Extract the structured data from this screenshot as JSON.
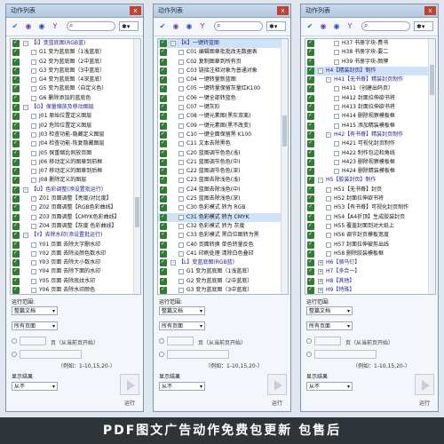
{
  "panels": [
    {
      "title": "动作列表",
      "close_label": "x",
      "scroll_thumb": {
        "top": 0.62,
        "height": 0.12
      },
      "rows": [
        {
          "indent": 0,
          "check": true,
          "expander": "-",
          "label": "【I】变蓝底图(RGB蓝)",
          "group": true
        },
        {
          "indent": 1,
          "check": true,
          "label": "G1 变为蓝底图（1浅蓝底）"
        },
        {
          "indent": 1,
          "check": true,
          "label": "G2 变为蓝底图（2中蓝底）"
        },
        {
          "indent": 1,
          "check": true,
          "label": "G3 变为蓝底图（3中蓝底）"
        },
        {
          "indent": 1,
          "check": true,
          "label": "G4 变为蓝底图（4深蓝底）"
        },
        {
          "indent": 1,
          "check": true,
          "label": "G5 变为蓝底图（自定义色）"
        },
        {
          "indent": 1,
          "check": true,
          "label": "G6 删除添加的蓝底色"
        },
        {
          "indent": 0,
          "check": true,
          "expander": "-",
          "label": "【O】保量缩放及移动图层",
          "group": true
        },
        {
          "indent": 1,
          "check": true,
          "label": "J01 原始位置定义图层"
        },
        {
          "indent": 1,
          "check": true,
          "label": "J02 危险位置定义图层"
        },
        {
          "indent": 1,
          "check": true,
          "label": "J03 检查功能-隐藏定义图层"
        },
        {
          "indent": 1,
          "check": true,
          "label": "J04 检查功能-恢复隐藏图层"
        },
        {
          "indent": 1,
          "check": true,
          "label": "J05 保重缩比例放页图"
        },
        {
          "indent": 1,
          "check": true,
          "label": "J06 移动定义的图章到前框"
        },
        {
          "indent": 1,
          "check": true,
          "label": "J07 移动定义的图章到后框"
        },
        {
          "indent": 1,
          "check": true,
          "label": "J08 删除定义的图层"
        },
        {
          "indent": 0,
          "check": true,
          "expander": "-",
          "label": "【U】色彩调整(添设置批运行)",
          "group": true
        },
        {
          "indent": 1,
          "check": true,
          "label": "Z01 页面调整【亮度/对比度】"
        },
        {
          "indent": 1,
          "check": true,
          "label": "Z02 页面调整【RGB色彩曲线】"
        },
        {
          "indent": 1,
          "check": true,
          "label": "Z03 页面调整【CMYK色彩曲线】"
        },
        {
          "indent": 1,
          "check": true,
          "label": "Z04 页面调整【灰度 色彩曲线】"
        },
        {
          "indent": 0,
          "check": true,
          "expander": "-",
          "label": "【Y】去除水印(添设置批运行)",
          "group": true
        },
        {
          "indent": 1,
          "check": true,
          "label": "Y01 页面 去除大字删水印"
        },
        {
          "indent": 1,
          "check": true,
          "label": "Y02 页面 去除淡颜色数水印"
        },
        {
          "indent": 1,
          "check": true,
          "label": "Y03 页面 去除大小数水印"
        },
        {
          "indent": 1,
          "check": true,
          "label": "Y04 页面 去除下面的水印"
        },
        {
          "indent": 1,
          "check": true,
          "label": "Y05 页面 去除底纹水印"
        },
        {
          "indent": 1,
          "check": true,
          "label": "Y06 页面 去除水印颜色"
        }
      ]
    },
    {
      "title": "动作列表",
      "close_label": "x",
      "scroll_thumb": {
        "top": 0.3,
        "height": 0.12
      },
      "rows": [
        {
          "indent": 0,
          "check": true,
          "expander": "-",
          "label": "【K】一键转蓝图",
          "group": true,
          "selected": true
        },
        {
          "indent": 1,
          "check": true,
          "label": "C01 编辑图章批批改无数据表"
        },
        {
          "indent": 1,
          "check": true,
          "label": "C02 复制图章到所有页"
        },
        {
          "indent": 1,
          "check": true,
          "label": "C03 链接注释对象为普通对象"
        },
        {
          "indent": 1,
          "check": true,
          "label": "C04 一键转量新蓝图"
        },
        {
          "indent": 1,
          "check": true,
          "label": "C05 一键转量保留灰量红K100"
        },
        {
          "indent": 1,
          "check": true,
          "label": "C06 一键全部转蓝色"
        },
        {
          "indent": 1,
          "check": true,
          "label": "C07 一键灰阶"
        },
        {
          "indent": 1,
          "check": true,
          "label": "C08 一键元素图(黑灰双离)"
        },
        {
          "indent": 1,
          "check": true,
          "label": "C09 一键元素图(黑不改变)"
        },
        {
          "indent": 1,
          "check": true,
          "label": "C10 一键全面保留黑 K100"
        },
        {
          "indent": 1,
          "check": true,
          "label": "C11 文本去除黑色"
        },
        {
          "indent": 1,
          "check": true,
          "label": "C20 蓝图调节色色(浅)"
        },
        {
          "indent": 1,
          "check": true,
          "label": "C21 蓝图调节色色(中)"
        },
        {
          "indent": 1,
          "check": true,
          "label": "C22 蓝图调节色色(深)"
        },
        {
          "indent": 1,
          "check": true,
          "label": "C23 蓝图去除浅色(浅)"
        },
        {
          "indent": 1,
          "check": true,
          "label": "C24 蓝图去除浅色(中)"
        },
        {
          "indent": 1,
          "check": true,
          "label": "C25 蓝图去除浅色(深)"
        },
        {
          "indent": 1,
          "check": true,
          "label": "C30 色彩模式 转为 RGB"
        },
        {
          "indent": 1,
          "check": true,
          "label": "C31 色彩模式 转为 CMYK",
          "selected": true
        },
        {
          "indent": 1,
          "check": true,
          "label": "C32 色彩模式 转为 灰度"
        },
        {
          "indent": 1,
          "check": true,
          "label": "C33 色彩模式 黑白位图转为黑"
        },
        {
          "indent": 1,
          "check": true,
          "label": "C40 页面转换 单色转量反色"
        },
        {
          "indent": 1,
          "check": true,
          "label": "C41 印刷处理 清除白色叠印"
        },
        {
          "indent": 0,
          "check": true,
          "expander": "-",
          "label": "【L】变蓝底图(RGB蓝)",
          "group": true
        },
        {
          "indent": 1,
          "check": true,
          "label": "G1 变为蓝底图（1浅蓝底）"
        },
        {
          "indent": 1,
          "check": true,
          "label": "G2 变为蓝底图（2中蓝底）"
        },
        {
          "indent": 1,
          "check": true,
          "label": "G3 变为蓝底图（3中蓝底）"
        }
      ]
    },
    {
      "title": "动作列表",
      "close_label": "x",
      "scroll_thumb": {
        "top": 0.1,
        "height": 0.12
      },
      "rows": [
        {
          "indent": 2,
          "check": true,
          "label": "H37 书册字块-费书"
        },
        {
          "indent": 2,
          "check": true,
          "label": "H38 书册字块-要二"
        },
        {
          "indent": 2,
          "check": true,
          "label": "H39 书册字块-颜牌"
        },
        {
          "indent": 0,
          "check": true,
          "expander": "-",
          "label": "H4【精装封页】制作",
          "group": true,
          "selected": true
        },
        {
          "indent": 1,
          "check": true,
          "expander": "-",
          "label": "H41【无书脊】精装封页制作",
          "group": true
        },
        {
          "indent": 2,
          "check": true,
          "label": "H411（创建出码页）"
        },
        {
          "indent": 2,
          "check": true,
          "label": "H412 封面拉伸欲书将"
        },
        {
          "indent": 2,
          "check": true,
          "label": "H413 封面拉伸欲书将"
        },
        {
          "indent": 2,
          "check": true,
          "label": "H414 删除视察模板框"
        },
        {
          "indent": 2,
          "check": true,
          "label": "H415 添加精装模板框"
        },
        {
          "indent": 1,
          "check": true,
          "expander": "-",
          "label": "H42【有书脊】精装封页制作",
          "group": true
        },
        {
          "indent": 2,
          "check": true,
          "label": "H421 可视化封页制作"
        },
        {
          "indent": 2,
          "check": true,
          "label": "H422 制作包边和角线"
        },
        {
          "indent": 2,
          "check": true,
          "label": "H423 删除视察模板框"
        },
        {
          "indent": 2,
          "check": true,
          "label": "H424 删除精装模板框"
        },
        {
          "indent": 0,
          "check": true,
          "expander": "-",
          "label": "H5【胶装封页】制作",
          "group": true
        },
        {
          "indent": 1,
          "check": true,
          "label": "H51【无书脊】封页"
        },
        {
          "indent": 1,
          "check": true,
          "label": "H52 封面拉伸欲书将"
        },
        {
          "indent": 1,
          "check": true,
          "label": "H53【有书脊】可视化封页制作"
        },
        {
          "indent": 1,
          "check": true,
          "label": "H54【A4折顶】生成胶装封页"
        },
        {
          "indent": 1,
          "check": true,
          "label": "H55 覆盖封面到对大纸上"
        },
        {
          "indent": 1,
          "check": true,
          "label": "H56 调节封页模板宽度"
        },
        {
          "indent": 1,
          "check": true,
          "label": "H57 封面拉伸被剪出线"
        },
        {
          "indent": 1,
          "check": true,
          "label": "H58 删除胶装模板框"
        },
        {
          "indent": 0,
          "check": true,
          "expander": "+",
          "label": "H6【骑马钉】",
          "group": true
        },
        {
          "indent": 0,
          "check": true,
          "expander": "+",
          "label": "H7【多合一】",
          "group": true
        },
        {
          "indent": 0,
          "check": true,
          "expander": "+",
          "label": "H8【其他】",
          "group": true
        },
        {
          "indent": 0,
          "check": true,
          "expander": "+",
          "label": "H9【特殊】",
          "group": true
        }
      ]
    }
  ],
  "controls": {
    "range_label": "运行范围:",
    "range_value": "整篇文档",
    "pages_value": "所有页面",
    "page_unit": "页（从当前页开始）",
    "example_hint": "（例如：1-10,15,20-）",
    "result_label": "显示结果",
    "result_value": "从不",
    "run_label": "运行"
  },
  "banner": {
    "text": "PDF图文广告动作免费包更新 包售后",
    "bg_color": "#2f3438"
  }
}
